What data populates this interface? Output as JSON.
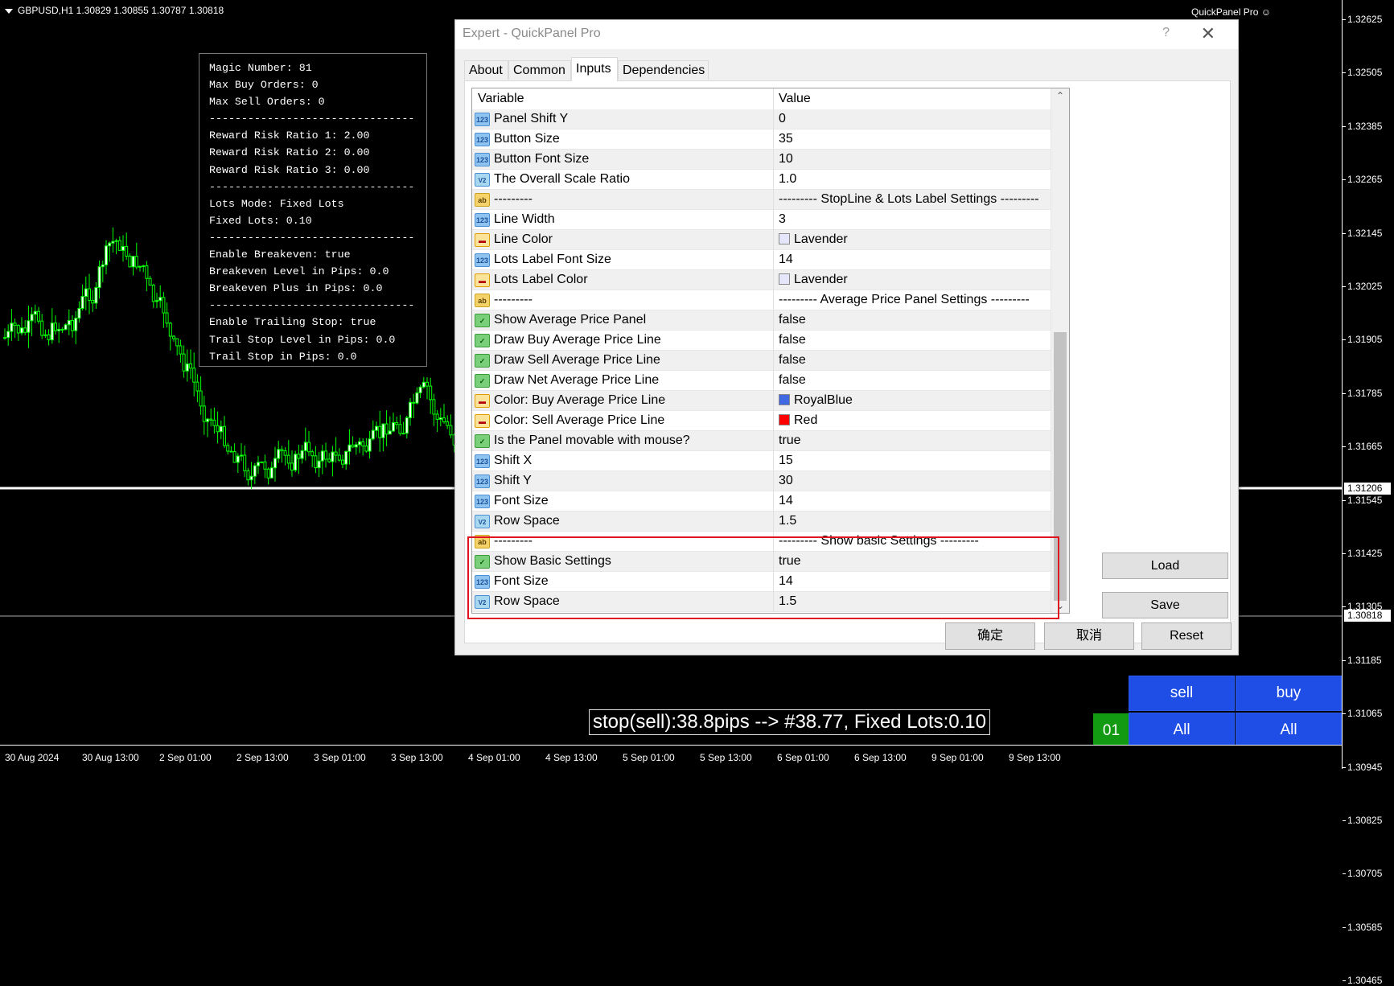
{
  "chart": {
    "symbol_info": "GBPUSD,H1  1.30829 1.30855 1.30787 1.30818",
    "ea_name": "QuickPanel Pro ☺",
    "price_ticks": [
      "1.32625",
      "1.32505",
      "1.32385",
      "1.32265",
      "1.32145",
      "1.32025",
      "1.31905",
      "1.31785",
      "1.31665",
      "1.31545",
      "1.31425",
      "1.31305",
      "1.31185",
      "1.31065",
      "1.30945",
      "1.30825",
      "1.30705",
      "1.30585",
      "1.30465"
    ],
    "price_tag_line": "1.31206",
    "price_tag_bid": "1.30818",
    "time_ticks": [
      "30 Aug 2024",
      "30 Aug 13:00",
      "2 Sep 01:00",
      "2 Sep 13:00",
      "3 Sep 01:00",
      "3 Sep 13:00",
      "4 Sep 01:00",
      "4 Sep 13:00",
      "5 Sep 01:00",
      "5 Sep 13:00",
      "6 Sep 01:00",
      "6 Sep 13:00",
      "9 Sep 01:00",
      "9 Sep 13:00"
    ]
  },
  "info_panel": {
    "lines": [
      "Magic Number: 81",
      "Max Buy Orders: 0",
      "Max Sell Orders: 0",
      "--------------------------------",
      "Reward Risk Ratio 1: 2.00",
      "Reward Risk Ratio 2: 0.00",
      "Reward Risk Ratio 3: 0.00",
      "--------------------------------",
      "Lots Mode: Fixed Lots",
      "Fixed Lots: 0.10",
      "--------------------------------",
      "Enable Breakeven: true",
      "Breakeven Level in Pips: 0.0",
      "Breakeven Plus in Pips: 0.0",
      "--------------------------------",
      "Enable Trailing Stop: true",
      "Trail Stop Level in Pips: 0.0",
      "Trail Stop in Pips: 0.0"
    ]
  },
  "trade": {
    "stop_label": "stop(sell):38.8pips --> #38.77, Fixed Lots:0.10",
    "sell_label": "sell",
    "buy_label": "buy",
    "all_left": "All",
    "all_right": "All",
    "lots_box": "01"
  },
  "dialog": {
    "title": "Expert - QuickPanel Pro",
    "help": "?",
    "close": "✕",
    "tabs": [
      {
        "label": "About"
      },
      {
        "label": "Common"
      },
      {
        "label": "Inputs"
      },
      {
        "label": "Dependencies"
      }
    ],
    "active_tab": "Inputs",
    "grid": {
      "col_variable": "Variable",
      "col_value": "Value",
      "rows": [
        {
          "type": "num",
          "icon": "123",
          "variable": "Panel Shift Y",
          "value": "0"
        },
        {
          "type": "num",
          "icon": "123",
          "variable": "Button Size",
          "value": "35"
        },
        {
          "type": "num",
          "icon": "123",
          "variable": "Button Font Size",
          "value": "10"
        },
        {
          "type": "dbl",
          "icon": "V2",
          "variable": "The Overall Scale Ratio",
          "value": "1.0"
        },
        {
          "type": "str",
          "icon": "ab",
          "variable": "---------",
          "value": "--------- StopLine & Lots Label Settings ---------"
        },
        {
          "type": "num",
          "icon": "123",
          "variable": "Line Width",
          "value": "3"
        },
        {
          "type": "clr",
          "icon": "▬",
          "variable": "Line Color",
          "value": "Lavender",
          "color": "#e6e6fa"
        },
        {
          "type": "num",
          "icon": "123",
          "variable": "Lots Label Font Size",
          "value": "14"
        },
        {
          "type": "clr",
          "icon": "▬",
          "variable": "Lots Label Color",
          "value": "Lavender",
          "color": "#e6e6fa"
        },
        {
          "type": "str",
          "icon": "ab",
          "variable": "---------",
          "value": "--------- Average Price Panel Settings ---------"
        },
        {
          "type": "bool",
          "icon": "✓",
          "variable": "Show Average Price Panel",
          "value": "false"
        },
        {
          "type": "bool",
          "icon": "✓",
          "variable": "Draw Buy Average Price Line",
          "value": "false"
        },
        {
          "type": "bool",
          "icon": "✓",
          "variable": "Draw Sell Average Price Line",
          "value": "false"
        },
        {
          "type": "bool",
          "icon": "✓",
          "variable": "Draw Net Average Price Line",
          "value": "false"
        },
        {
          "type": "clr",
          "icon": "▬",
          "variable": "Color: Buy Average Price Line",
          "value": "RoyalBlue",
          "color": "#4169e1"
        },
        {
          "type": "clr",
          "icon": "▬",
          "variable": "Color: Sell Average Price Line",
          "value": "Red",
          "color": "#ff0000"
        },
        {
          "type": "bool",
          "icon": "✓",
          "variable": "Is the Panel movable with mouse?",
          "value": "true"
        },
        {
          "type": "num",
          "icon": "123",
          "variable": "Shift X",
          "value": "15"
        },
        {
          "type": "num",
          "icon": "123",
          "variable": "Shift Y",
          "value": "30"
        },
        {
          "type": "num",
          "icon": "123",
          "variable": "Font Size",
          "value": "14"
        },
        {
          "type": "dbl",
          "icon": "V2",
          "variable": "Row Space",
          "value": "1.5"
        },
        {
          "type": "str",
          "icon": "ab",
          "variable": "---------",
          "value": "--------- Show basic Settings ---------"
        },
        {
          "type": "bool",
          "icon": "✓",
          "variable": "Show Basic Settings",
          "value": "true"
        },
        {
          "type": "num",
          "icon": "123",
          "variable": "Font Size",
          "value": "14"
        },
        {
          "type": "dbl",
          "icon": "V2",
          "variable": "Row Space",
          "value": "1.5"
        }
      ]
    },
    "buttons": {
      "load": "Load",
      "save": "Save",
      "ok": "确定",
      "cancel": "取消",
      "reset": "Reset"
    }
  }
}
